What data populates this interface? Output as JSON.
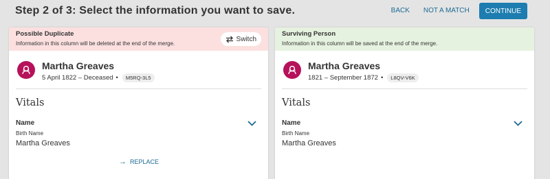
{
  "header": {
    "step_title": "Step 2 of 3: Select the information you want to save.",
    "back_label": "BACK",
    "not_match_label": "NOT A MATCH",
    "continue_label": "CONTINUE"
  },
  "left_panel": {
    "title": "Possible Duplicate",
    "subtitle": "Information in this column will be deleted at the end of the merge.",
    "switch_label": "Switch",
    "person": {
      "name": "Martha Greaves",
      "dates": "5 April 1822 – Deceased",
      "separator": "•",
      "id": "M5RQ-3L5"
    },
    "section_title": "Vitals",
    "field_label": "Name",
    "field_sublabel": "Birth Name",
    "field_value": "Martha Greaves",
    "replace_label": "REPLACE"
  },
  "right_panel": {
    "title": "Surviving Person",
    "subtitle": "Information in this column will be saved at the end of the merge.",
    "person": {
      "name": "Martha Greaves",
      "dates": "1821 – September 1872",
      "separator": "•",
      "id": "L8QV-V6K"
    },
    "section_title": "Vitals",
    "field_label": "Name",
    "field_sublabel": "Birth Name",
    "field_value": "Martha Greaves"
  },
  "icons": {
    "switch": "swap-arrows-icon",
    "avatar": "female-person-icon",
    "expand": "chevron-down-icon",
    "replace": "arrow-right-icon"
  },
  "colors": {
    "accent": "#1d7db0",
    "link": "#1d6a93",
    "duplicate_header": "#fce0e0",
    "surviving_header": "#e6f2e0",
    "avatar": "#b6115a"
  }
}
